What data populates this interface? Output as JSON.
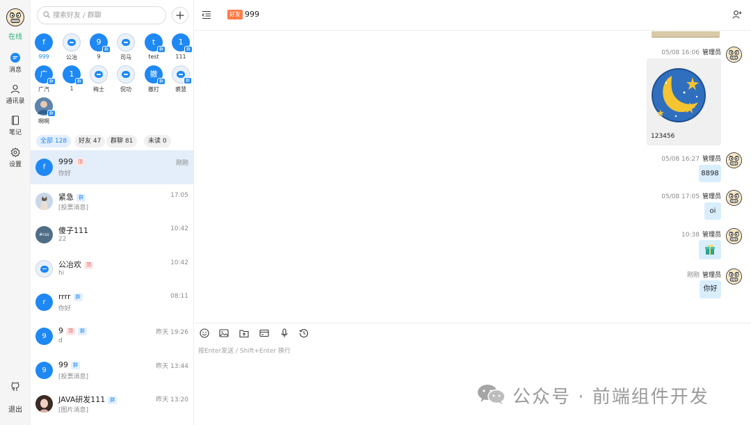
{
  "rail": {
    "status": "在线",
    "nav": [
      {
        "label": "消息",
        "icon": "message-icon"
      },
      {
        "label": "通讯录",
        "icon": "contacts-icon"
      },
      {
        "label": "笔记",
        "icon": "notes-icon"
      },
      {
        "label": "设置",
        "icon": "settings-icon"
      }
    ],
    "logout": "退出"
  },
  "search": {
    "placeholder": "搜索好友 / 群聊"
  },
  "quick_contacts": [
    {
      "avatar_text": "f",
      "label": "999",
      "group": false,
      "style": "solid",
      "active": true
    },
    {
      "avatar_text": "",
      "label": "公冶",
      "group": false,
      "style": "bubble"
    },
    {
      "avatar_text": "9",
      "label": "9",
      "group": true,
      "style": "solid"
    },
    {
      "avatar_text": "",
      "label": "司马",
      "group": false,
      "style": "bubble"
    },
    {
      "avatar_text": "t",
      "label": "test",
      "group": true,
      "style": "solid"
    },
    {
      "avatar_text": "1",
      "label": "111",
      "group": true,
      "style": "solid"
    },
    {
      "avatar_text": "广",
      "label": "广汽",
      "group": true,
      "style": "solid"
    },
    {
      "avatar_text": "1",
      "label": "1",
      "group": true,
      "style": "solid"
    },
    {
      "avatar_text": "",
      "label": "梅士",
      "group": false,
      "style": "bubble"
    },
    {
      "avatar_text": "",
      "label": "倪功",
      "group": false,
      "style": "bubble"
    },
    {
      "avatar_text": "撤",
      "label": "撤打",
      "group": true,
      "style": "solid"
    },
    {
      "avatar_text": "",
      "label": "裘慧",
      "group": true,
      "style": "bubble"
    },
    {
      "avatar_text": "",
      "label": "啊啊",
      "group": true,
      "style": "photo"
    }
  ],
  "group_badge": "群",
  "filters": [
    {
      "label": "全部 128",
      "active": true
    },
    {
      "label": "好友 47",
      "active": false
    },
    {
      "label": "群聊 81",
      "active": false
    },
    {
      "label": "未读 0",
      "active": false
    }
  ],
  "tags": {
    "top": "顶",
    "group": "群",
    "avatar_css": "#css"
  },
  "conversations": [
    {
      "avatar": "f",
      "style": "solid",
      "title": "999",
      "top": true,
      "group": false,
      "preview": "你好",
      "time": "刚刚",
      "selected": true
    },
    {
      "avatar": "",
      "style": "cat",
      "title": "紧急",
      "top": false,
      "group": true,
      "preview": "[投票消息]",
      "time": "17:05"
    },
    {
      "avatar": "#css",
      "style": "dark",
      "title": "傻子111",
      "top": false,
      "group": false,
      "preview": "22",
      "time": "10:42"
    },
    {
      "avatar": "",
      "style": "bubble",
      "title": "公冶欢",
      "top": true,
      "group": false,
      "preview": "hi",
      "time": "10:42"
    },
    {
      "avatar": "r",
      "style": "solid",
      "title": "rrrr",
      "top": false,
      "group": true,
      "preview": "你好",
      "time": "08:11"
    },
    {
      "avatar": "9",
      "style": "solid",
      "title": "9",
      "top": true,
      "group": true,
      "preview": "d",
      "time": "昨天 19:26"
    },
    {
      "avatar": "9",
      "style": "solid",
      "title": "99",
      "top": false,
      "group": true,
      "preview": "[投票消息]",
      "time": "昨天 13:44"
    },
    {
      "avatar": "",
      "style": "girl",
      "title": "JAVA研发111",
      "top": false,
      "group": true,
      "preview": "[图片消息]",
      "time": "昨天 13:20"
    }
  ],
  "chat": {
    "friend_tag": "好友",
    "title": "999",
    "messages": [
      {
        "time": "05/08 16:06",
        "sender": "管理员",
        "type": "image",
        "caption": "123456"
      },
      {
        "time": "05/08 16:27",
        "sender": "管理员",
        "type": "text",
        "text": "8898"
      },
      {
        "time": "05/08 17:05",
        "sender": "管理员",
        "type": "text",
        "text": "oi"
      },
      {
        "time": "10:38",
        "sender": "管理员",
        "type": "emoji",
        "text": "🎁"
      },
      {
        "time": "刚刚",
        "sender": "管理员",
        "type": "text",
        "text": "你好"
      }
    ],
    "input_placeholder": "按Enter发送 / Shift+Enter 换行",
    "tools": [
      "emoji-icon",
      "image-icon",
      "file-upload-icon",
      "card-icon",
      "microphone-icon",
      "history-icon"
    ]
  },
  "watermark": "公众号 · 前端组件开发",
  "colors": {
    "accent": "#1e88f5",
    "online": "#26b36a",
    "bubble": "#d9eefd",
    "friend_tag": "#ff7a45"
  }
}
